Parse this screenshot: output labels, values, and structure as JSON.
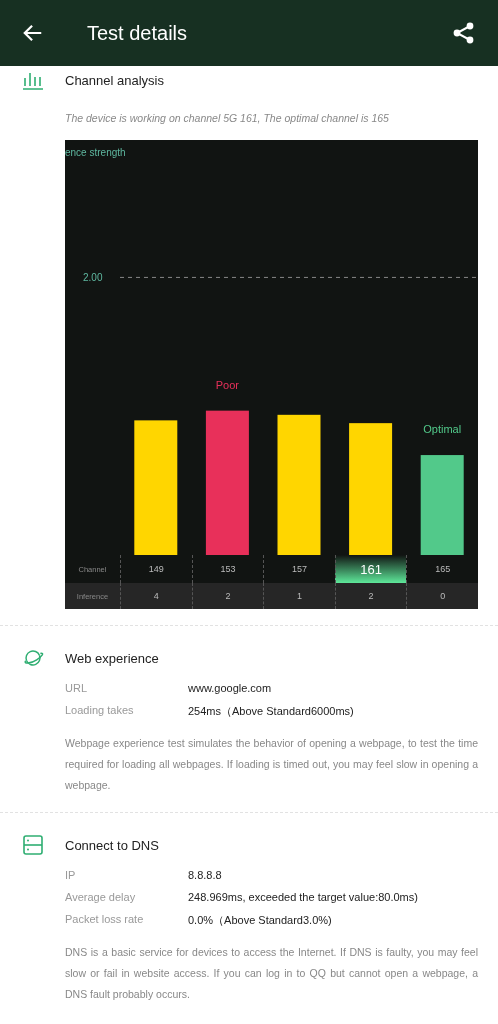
{
  "header": {
    "title": "Test details"
  },
  "channel_analysis": {
    "title": "Channel analysis",
    "summary": "The device is working on channel 5G 161, The optimal channel is 165",
    "chart_data": {
      "type": "bar",
      "ylabel": "ence strength",
      "categories": [
        "149",
        "153",
        "157",
        "161",
        "165"
      ],
      "series": [
        {
          "values": [
            0.97,
            1.04,
            1.01,
            0.95,
            0.72
          ]
        }
      ],
      "ylim": [
        0,
        2.99
      ],
      "yticks": [
        {
          "value": 2,
          "label": "2.00"
        }
      ]
    },
    "bars": [
      {
        "color": "#ffd600"
      },
      {
        "color": "#e8305a",
        "tag": "Poor"
      },
      {
        "color": "#ffd600"
      },
      {
        "color": "#ffd600"
      },
      {
        "color": "#52c98a",
        "tag": "Optimal"
      }
    ],
    "channel_row": {
      "label": "Channel",
      "cells": [
        {
          "selected": false
        },
        {
          "selected": false
        },
        {
          "selected": false
        },
        {
          "selected": true
        },
        {
          "selected": false
        }
      ]
    },
    "inference_row": {
      "label": "Inference",
      "cells": [
        "4",
        "2",
        "1",
        "2",
        "0"
      ]
    }
  },
  "web_experience": {
    "title": "Web experience",
    "rows": [
      {
        "label": "URL",
        "value": "www.google.com"
      },
      {
        "label": "Loading takes",
        "value": "254ms（Above Standard6000ms)"
      }
    ],
    "description": "Webpage experience test simulates the behavior of opening a webpage, to test the time required for loading all webpages. If loading is timed out, you may feel slow in opening a webpage."
  },
  "dns": {
    "title": "Connect to DNS",
    "rows": [
      {
        "label": "IP",
        "value": "8.8.8.8"
      },
      {
        "label": "Average delay",
        "value": "248.969ms, exceeded the target value:80.0ms)"
      },
      {
        "label": "Packet loss rate",
        "value": "0.0%（Above Standard3.0%)"
      }
    ],
    "description": "DNS is a basic service for devices to access the Internet. If DNS is faulty, you may feel slow or fail in website access. If you can log in to QQ but cannot open a webpage, a DNS fault probably occurs."
  }
}
